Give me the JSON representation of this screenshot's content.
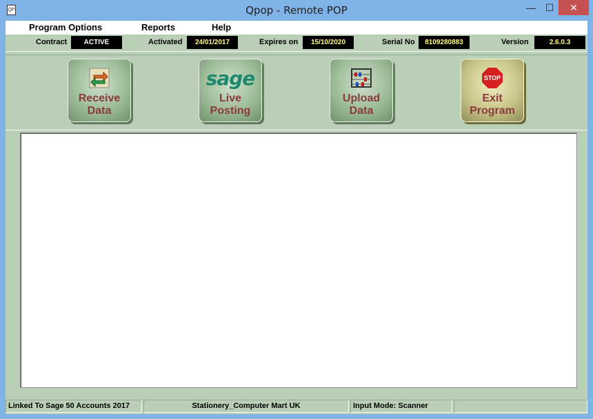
{
  "window": {
    "title": "Qpop - Remote POP",
    "app_icon_text": "QP"
  },
  "window_controls": {
    "minimize": "—",
    "maximize": "☐",
    "close": "✕"
  },
  "menu": [
    "Program Options",
    "Reports",
    "Help"
  ],
  "info": {
    "contract_label": "Contract",
    "contract_value": "ACTIVE",
    "activated_label": "Activated",
    "activated_value": "24/01/2017",
    "expires_label": "Expires on",
    "expires_value": "15/10/2020",
    "serial_label": "Serial No",
    "serial_value": "8109280883",
    "version_label": "Version",
    "version_value": "2.6.0.3"
  },
  "toolbar": {
    "receive": {
      "label": "Receive\nData",
      "icon": "sync-arrows-icon"
    },
    "sage": {
      "label": "Live\nPosting",
      "logo": "sage",
      "icon": "sage-logo-icon"
    },
    "upload": {
      "label": "Upload\nData",
      "icon": "abacus-icon"
    },
    "exit": {
      "label": "Exit\nProgram",
      "stop": "STOP",
      "icon": "stop-sign-icon"
    }
  },
  "status": {
    "linked": "Linked To Sage 50 Accounts 2017",
    "company": "Stationery_Computer Mart UK",
    "input_mode": "Input Mode: Scanner",
    "extra": ""
  },
  "colors": {
    "window_frame": "#7fb2e6",
    "panel": "#b9cfb6",
    "label_text": "#8a3a3a",
    "value_text": "#ffff80",
    "close_button": "#c75050"
  }
}
